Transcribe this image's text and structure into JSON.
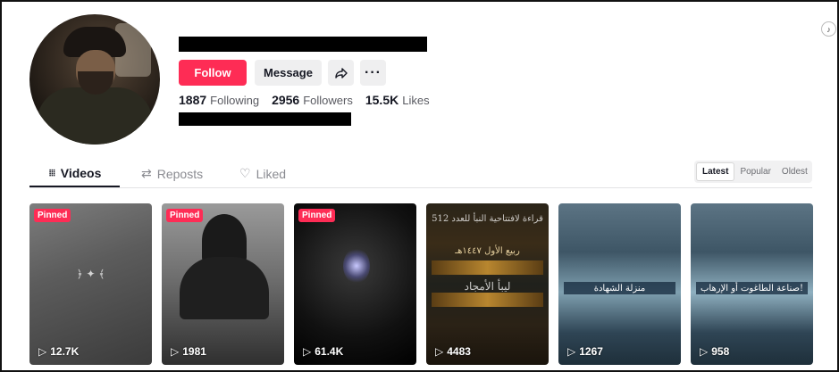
{
  "profile": {
    "follow_label": "Follow",
    "message_label": "Message",
    "more_label": "···",
    "stats": [
      {
        "value": "1887",
        "label": "Following"
      },
      {
        "value": "2956",
        "label": "Followers"
      },
      {
        "value": "15.5K",
        "label": "Likes"
      }
    ]
  },
  "tabs": [
    {
      "label": "Videos",
      "icon": "grid-icon",
      "glyph": "⦙⦙⦙"
    },
    {
      "label": "Reposts",
      "icon": "repost-icon",
      "glyph": "⇄"
    },
    {
      "label": "Liked",
      "icon": "heart-icon",
      "glyph": "♡"
    }
  ],
  "sort": {
    "options": [
      "Latest",
      "Popular",
      "Oldest"
    ],
    "selected": "Latest"
  },
  "videos": [
    {
      "pinned": "Pinned",
      "views": "12.7K"
    },
    {
      "pinned": "Pinned",
      "views": "1981"
    },
    {
      "pinned": "Pinned",
      "views": "61.4K"
    },
    {
      "views": "4483",
      "overlay_1": "قراءة لافتتاحية النبأ للعدد 512",
      "overlay_2": "ربيع الأول ١٤٤٧هـ",
      "overlay_3": "ليبأ الأمجاد"
    },
    {
      "views": "1267",
      "overlay_1": "منزلة الشهادة"
    },
    {
      "views": "958",
      "overlay_1": "صناعة الطاغوت أو الإرهاب!"
    }
  ],
  "colors": {
    "accent": "#fe2c55",
    "text": "#161823",
    "muted": "#8a8b91"
  }
}
